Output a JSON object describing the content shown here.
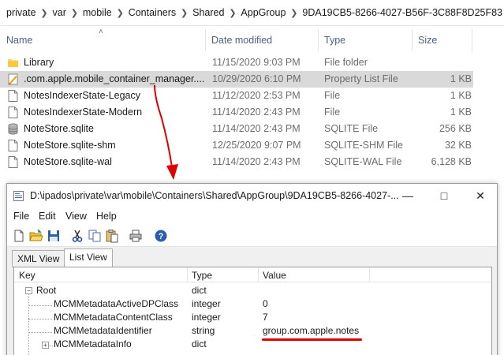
{
  "breadcrumb": [
    "private",
    "var",
    "mobile",
    "Containers",
    "Shared",
    "AppGroup",
    "9DA19CB5-8266-4027-B56F-3C88F8D25F83"
  ],
  "columns": {
    "name": "Name",
    "date": "Date modified",
    "type": "Type",
    "size": "Size"
  },
  "files": [
    {
      "name": "Library",
      "date": "11/15/2020 9:03 PM",
      "type": "File folder",
      "size": "",
      "icon": "folder-icon"
    },
    {
      "name": ".com.apple.mobile_container_manager....",
      "date": "10/29/2020 6:10 PM",
      "type": "Property List File",
      "size": "1 KB",
      "icon": "plist-icon",
      "selected": true
    },
    {
      "name": "NotesIndexerState-Legacy",
      "date": "11/12/2020 2:53 PM",
      "type": "File",
      "size": "1 KB",
      "icon": "file-icon"
    },
    {
      "name": "NotesIndexerState-Modern",
      "date": "11/14/2020 2:43 PM",
      "type": "File",
      "size": "1 KB",
      "icon": "file-icon"
    },
    {
      "name": "NoteStore.sqlite",
      "date": "11/14/2020 2:43 PM",
      "type": "SQLITE File",
      "size": "256 KB",
      "icon": "database-icon"
    },
    {
      "name": "NoteStore.sqlite-shm",
      "date": "12/25/2020 9:07 PM",
      "type": "SQLITE-SHM File",
      "size": "32 KB",
      "icon": "file-icon"
    },
    {
      "name": "NoteStore.sqlite-wal",
      "date": "11/14/2020 2:43 PM",
      "type": "SQLITE-WAL File",
      "size": "6,128 KB",
      "icon": "file-icon"
    }
  ],
  "editor": {
    "title": "D:\\ipados\\private\\var\\mobile\\Containers\\Shared\\AppGroup\\9DA19CB5-8266-4027-...",
    "menu": [
      "File",
      "Edit",
      "View",
      "Help"
    ],
    "tabs": [
      "XML View",
      "List View"
    ],
    "active_tab": "List View",
    "list_columns": {
      "key": "Key",
      "type": "Type",
      "value": "Value"
    },
    "rows": [
      {
        "key": "Root",
        "type": "dict",
        "value": ""
      },
      {
        "key": "MCMMetadataActiveDPClass",
        "type": "integer",
        "value": "0"
      },
      {
        "key": "MCMMetadataContentClass",
        "type": "integer",
        "value": "7"
      },
      {
        "key": "MCMMetadataIdentifier",
        "type": "string",
        "value": "group.com.apple.notes"
      },
      {
        "key": "MCMMetadataInfo",
        "type": "dict",
        "value": ""
      }
    ]
  },
  "colors": {
    "selection": "#d9d9d9",
    "annotation": "#e00000",
    "header_text": "#4c5f85"
  }
}
